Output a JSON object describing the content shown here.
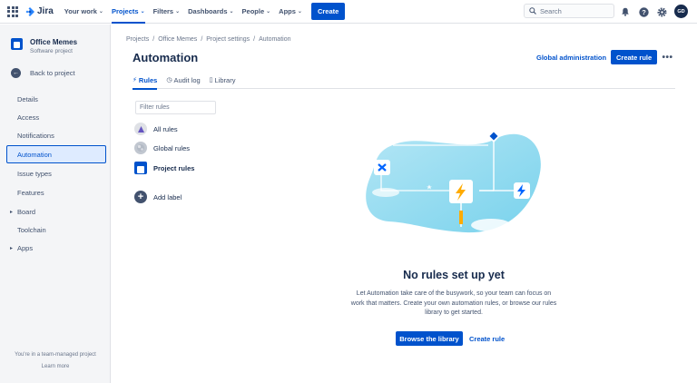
{
  "topnav": {
    "logo": "Jira",
    "items": [
      {
        "label": "Your work"
      },
      {
        "label": "Projects"
      },
      {
        "label": "Filters"
      },
      {
        "label": "Dashboards"
      },
      {
        "label": "People"
      },
      {
        "label": "Apps"
      }
    ],
    "create_label": "Create",
    "search_placeholder": "Search",
    "avatar_initials": "GD",
    "accent": "#0052CC"
  },
  "sidebar": {
    "project_name": "Office Memes",
    "project_type": "Software project",
    "back_label": "Back to project",
    "items": [
      {
        "label": "Details"
      },
      {
        "label": "Access"
      },
      {
        "label": "Notifications"
      },
      {
        "label": "Automation"
      },
      {
        "label": "Issue types"
      },
      {
        "label": "Features"
      },
      {
        "label": "Board"
      },
      {
        "label": "Toolchain"
      },
      {
        "label": "Apps"
      }
    ],
    "footer_text": "You're in a team-managed project",
    "footer_link": "Learn more"
  },
  "breadcrumb": [
    "Projects",
    "Office Memes",
    "Project settings",
    "Automation"
  ],
  "header": {
    "title": "Automation",
    "global_admin": "Global administration",
    "create_rule": "Create rule"
  },
  "tabs": [
    {
      "label": "Rules",
      "icon": "lightning-icon"
    },
    {
      "label": "Audit log",
      "icon": "clock-icon"
    },
    {
      "label": "Library",
      "icon": "book-icon"
    }
  ],
  "filter": {
    "placeholder": "Filter rules"
  },
  "rule_groups": [
    {
      "label": "All rules",
      "icon": "all-rules-icon"
    },
    {
      "label": "Global rules",
      "icon": "globe-icon"
    },
    {
      "label": "Project rules",
      "icon": "project-icon"
    }
  ],
  "add_label": "Add label",
  "empty_state": {
    "title": "No rules set up yet",
    "description": "Let Automation take care of the busywork, so your team can focus on work that matters. Create your own automation rules, or browse our rules library to get started.",
    "browse_button": "Browse the library",
    "create_link": "Create rule"
  }
}
